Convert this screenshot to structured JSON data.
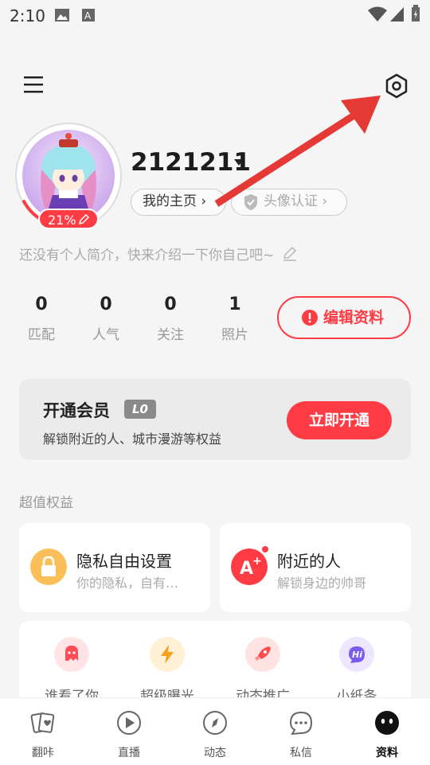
{
  "status_bar": {
    "time": "2:10"
  },
  "profile": {
    "username": "2121211",
    "completion": "21%",
    "homepage_label": "我的主页 ›",
    "verify_label": "头像认证 ›",
    "bio_placeholder": "还没有个人简介，快来介绍一下你自己吧~"
  },
  "stats": [
    {
      "value": "0",
      "label": "匹配"
    },
    {
      "value": "0",
      "label": "人气"
    },
    {
      "value": "0",
      "label": "关注"
    },
    {
      "value": "1",
      "label": "照片"
    }
  ],
  "edit_button": "编辑资料",
  "vip": {
    "title": "开通会员",
    "level": "L0",
    "subtitle": "解锁附近的人、城市漫游等权益",
    "button": "立即开通"
  },
  "benefits_section": {
    "title": "超值权益",
    "items": [
      {
        "title": "隐私自由设置",
        "subtitle": "你的隐私，自有…"
      },
      {
        "title": "附近的人",
        "subtitle": "解锁身边的帅哥"
      }
    ]
  },
  "features": [
    {
      "label": "谁看了你",
      "icon": "ghost-icon"
    },
    {
      "label": "超级曝光",
      "icon": "lightning-icon"
    },
    {
      "label": "动态推广",
      "icon": "rocket-icon"
    },
    {
      "label": "小纸条",
      "icon": "hi-bubble-icon"
    }
  ],
  "bottom_nav": [
    {
      "label": "翻咔",
      "icon": "cards-icon"
    },
    {
      "label": "直播",
      "icon": "play-icon"
    },
    {
      "label": "动态",
      "icon": "compass-icon"
    },
    {
      "label": "私信",
      "icon": "chat-icon"
    },
    {
      "label": "资料",
      "icon": "profile-face-icon",
      "active": true
    }
  ],
  "colors": {
    "accent": "#ff3b43",
    "background": "#f5f5f5",
    "card": "#ffffff"
  }
}
